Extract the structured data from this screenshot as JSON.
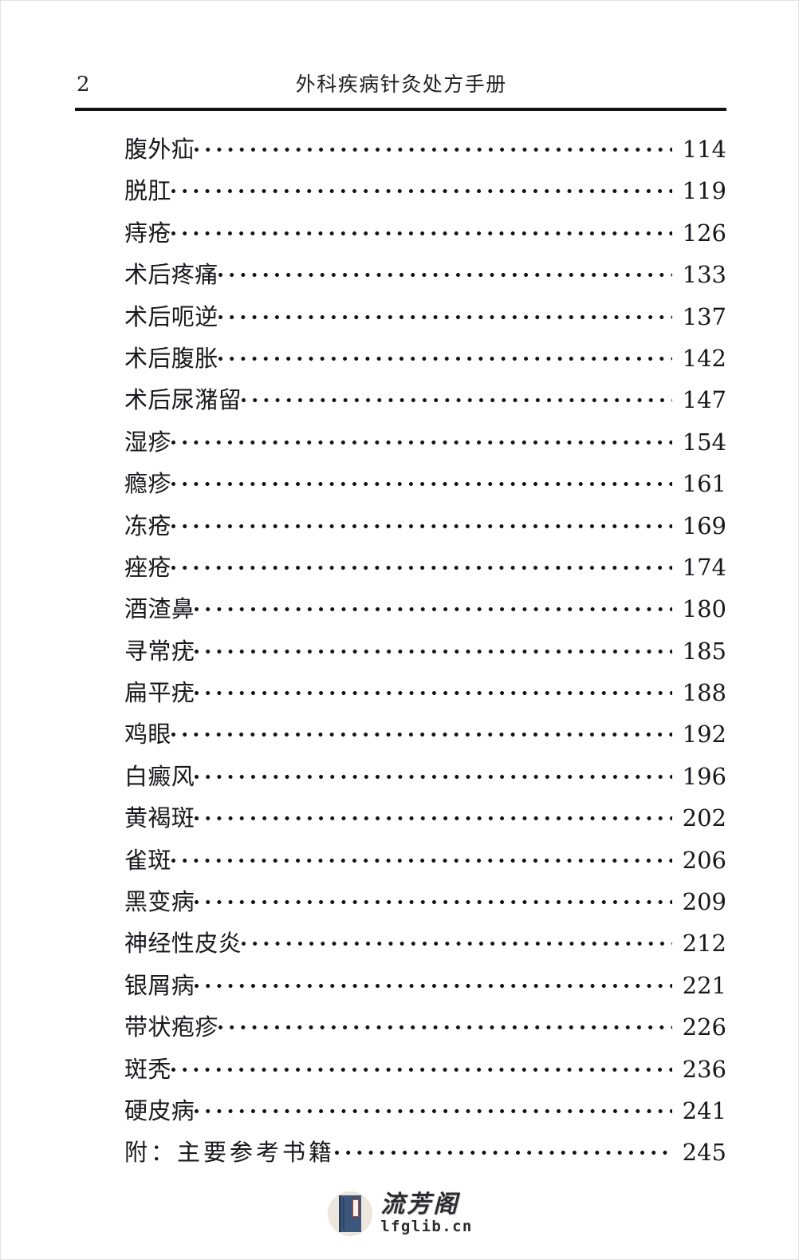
{
  "document": {
    "page_type": "table-of-contents",
    "folio": "2",
    "running_head": "外科疾病针灸处方手册"
  },
  "toc": {
    "entries": [
      {
        "label": "腹外疝",
        "page": "114"
      },
      {
        "label": "脱肛",
        "page": "119"
      },
      {
        "label": "痔疮",
        "page": "126"
      },
      {
        "label": "术后疼痛",
        "page": "133"
      },
      {
        "label": "术后呃逆",
        "page": "137"
      },
      {
        "label": "术后腹胀",
        "page": "142"
      },
      {
        "label": "术后尿潴留",
        "page": "147"
      },
      {
        "label": "湿疹",
        "page": "154"
      },
      {
        "label": "瘾疹",
        "page": "161"
      },
      {
        "label": "冻疮",
        "page": "169"
      },
      {
        "label": "痤疮",
        "page": "174"
      },
      {
        "label": "酒渣鼻",
        "page": "180"
      },
      {
        "label": "寻常疣",
        "page": "185"
      },
      {
        "label": "扁平疣",
        "page": "188"
      },
      {
        "label": "鸡眼",
        "page": "192"
      },
      {
        "label": "白癜风",
        "page": "196"
      },
      {
        "label": "黄褐斑",
        "page": "202"
      },
      {
        "label": "雀斑",
        "page": "206"
      },
      {
        "label": "黑变病",
        "page": "209"
      },
      {
        "label": "神经性皮炎",
        "page": "212"
      },
      {
        "label": "银屑病",
        "page": "221"
      },
      {
        "label": "带状疱疹",
        "page": "226"
      },
      {
        "label": "斑秃",
        "page": "236"
      },
      {
        "label": "硬皮病",
        "page": "241"
      },
      {
        "label": "附：主要参考书籍",
        "page": "245",
        "wide": true
      }
    ]
  },
  "watermark": {
    "site_name": "流芳阁",
    "site_url": "lfglib.cn",
    "icon": "book-icon",
    "badge_color": "#ece6dc",
    "book_color": "#3d567c"
  }
}
